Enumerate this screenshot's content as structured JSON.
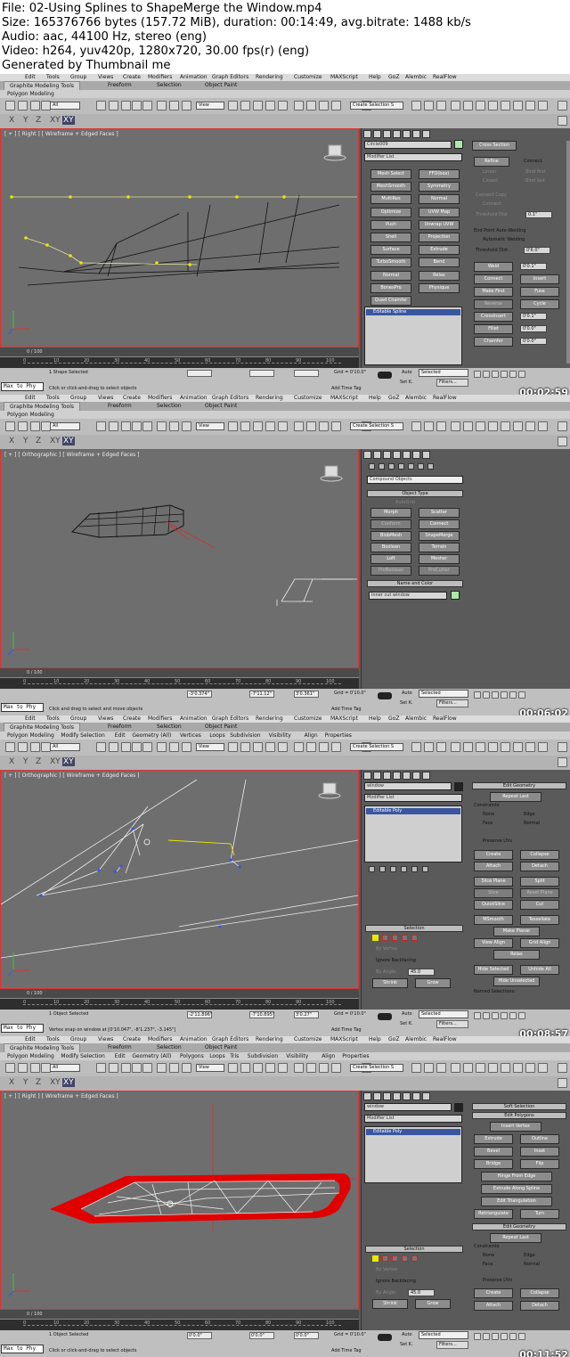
{
  "header": {
    "line1": "File: 02-Using Splines to ShapeMerge the Window.mp4",
    "line2": "Size: 165376766 bytes (157.72 MiB), duration: 00:14:49, avg.bitrate: 1488 kb/s",
    "line3": "Audio: aac, 44100 Hz, stereo (eng)",
    "line4": "Video: h264, yuv420p, 1280x720, 30.00 fps(r) (eng)",
    "line5": "Generated by Thumbnail me"
  },
  "menu": [
    "Edit",
    "Tools",
    "Group",
    "Views",
    "Create",
    "Modifiers",
    "Animation",
    "Graph Editors",
    "Rendering",
    "Customize",
    "MAXScript",
    "Help",
    "GoZ",
    "Alembic",
    "RealFlow"
  ],
  "ribbon_tabs": [
    "Graphite Modeling Tools",
    "Freeform",
    "Selection",
    "Object Paint"
  ],
  "ribbon_sub_default": [
    "Polygon Modeling"
  ],
  "ribbon_sub_f3": [
    "Polygon Modeling",
    "Modify Selection",
    "Edit",
    "Geometry (All)",
    "Vertices",
    "Loops",
    "Subdivision",
    "Visibility",
    "Align",
    "Properties"
  ],
  "ribbon_sub_f4": [
    "Polygon Modeling",
    "Modify Selection",
    "Edit",
    "Geometry (All)",
    "Polygons",
    "Loops",
    "Tris",
    "Subdivision",
    "Visibility",
    "Align",
    "Properties"
  ],
  "toolbar": {
    "filter": "All",
    "view": "View",
    "named_sel": "Create Selection S",
    "axis": [
      "X",
      "Y",
      "Z",
      "XY",
      "XY"
    ]
  },
  "common": {
    "timeline": "0 / 100",
    "max_to": "Max to Phy",
    "add_time_tag": "Add Time Tag",
    "auto": "Auto",
    "setk": "Set K.",
    "selected": "Selected",
    "filters": "Filters...",
    "modifier_list": "Modifier List",
    "ticks": [
      "0",
      "10",
      "20",
      "30",
      "40",
      "50",
      "60",
      "70",
      "80",
      "90",
      "100"
    ]
  },
  "frames": [
    {
      "viewport": "[ + ] [ Right ] [ Wireframe + Edged Faces ]",
      "status1": "1 Shape Selected",
      "status2": "Click or click-and-drag to select objects",
      "grid": "Grid = 0'10.0\"",
      "coords": [
        "",
        "",
        ""
      ],
      "timestamp": "00:02:59",
      "object_name": "Circle009",
      "modifier_buttons": [
        [
          "Mesh Select",
          "FFD(box)"
        ],
        [
          "MeshSmooth",
          "Symmetry"
        ],
        [
          "MultiRes",
          "Normal"
        ],
        [
          "Optimize",
          "UVW Map"
        ],
        [
          "Push",
          "Unwrap UVW"
        ],
        [
          "Shell",
          "Projection"
        ],
        [
          "Surface",
          "Extrude"
        ],
        [
          "TurboSmooth",
          "Bend"
        ],
        [
          "Normal",
          "Relax"
        ],
        [
          "BonesPro",
          "Physique"
        ],
        [
          "Quad Chamfer",
          ""
        ]
      ],
      "stack_item": "Editable Spline",
      "right": {
        "cross_section": "Cross Section",
        "refine": "Refine",
        "connect_chk": "Connect",
        "linear": "Linear",
        "bind_first": "Bind first",
        "closed": "Closed",
        "bind_last": "Bind last",
        "connect_copy": "Connect Copy",
        "connect2": "Connect",
        "threshold": "Threshold Dist",
        "threshold_val": "0.1\"",
        "end_weld": "End Point Auto-Welding",
        "auto_weld": "Automatic Welding",
        "threshold2": "Threshold Dist.",
        "threshold2_val": "0'6.0\"",
        "weld": "Weld",
        "weld_val": "0'0.1\"",
        "connect_btn": "Connect",
        "insert": "Insert",
        "make_first": "Make First",
        "fuse": "Fuse",
        "reverse": "Reverse",
        "cycle": "Cycle",
        "crossinsert": "CrossInsert",
        "crossinsert_val": "0'0.1\"",
        "fillet": "Fillet",
        "fillet_val": "0'0.0\"",
        "chamfer": "Chamfer",
        "chamfer_val": "0'0.0\""
      }
    },
    {
      "viewport": "[ + ] [ Orthographic ] [ Wireframe + Edged Faces ]",
      "status1": "",
      "status2": "Click and drag to select and move objects",
      "grid": "Grid = 0'10.0\"",
      "coords": [
        "-3'0.374\"",
        "-7'11.12\"",
        "3'0.361\""
      ],
      "timestamp": "00:06:02",
      "dropdown": "Compound Objects",
      "object_type": "Object Type",
      "autogrid": "AutoGrid",
      "buttons": [
        [
          "Morph",
          "Scatter"
        ],
        [
          "Conform",
          "Connect"
        ],
        [
          "BlobMesh",
          "ShapeMerge"
        ],
        [
          "Boolean",
          "Terrain"
        ],
        [
          "Loft",
          "Mesher"
        ],
        [
          "ProBoolean",
          "ProCutter"
        ]
      ],
      "name_color": "Name and Color",
      "name": "inner cut window"
    },
    {
      "viewport": "[ + ] [ Orthographic ] [ Wireframe + Edged Faces ]",
      "status1": "1 Object Selected",
      "status2": "Vertex snap on window at [0'10.047\", -8'1.237\", -3.145\"]",
      "grid": "Grid = 0'10.0\"",
      "coords": [
        "-2'11.896\"",
        "-7'10.895\"",
        "3'0.27\""
      ],
      "timestamp": "00:08:57",
      "object_name": "window",
      "stack_item": "Editable Poly",
      "selection": "Selection",
      "by_vertex": "By Vertex",
      "ignore_backfacing": "Ignore Backfacing",
      "by_angle": "By Angle:",
      "by_angle_val": "45.0",
      "shrink": "Shrink",
      "grow": "Grow",
      "right": {
        "edit_geometry": "Edit Geometry",
        "repeat_last": "Repeat Last",
        "constraints": "Constraints",
        "none": "None",
        "edge": "Edge",
        "face": "Face",
        "normal": "Normal",
        "preserve_uvs": "Preserve UVs",
        "create": "Create",
        "collapse": "Collapse",
        "attach": "Attach",
        "detach": "Detach",
        "slice_plane": "Slice Plane",
        "split": "Split",
        "slice": "Slice",
        "reset_plane": "Reset Plane",
        "quickslice": "QuickSlice",
        "cut": "Cut",
        "msmooth": "MSmooth",
        "tessellate": "Tessellate",
        "make_planar": "Make Planar",
        "view_align": "View Align",
        "grid_align": "Grid Align",
        "relax": "Relax",
        "hide_selected": "Hide Selected",
        "unhide_all": "Unhide All",
        "hide_unselected": "Hide Unselected",
        "named_selections": "Named Selections:"
      }
    },
    {
      "viewport": "[ + ] [ Right ] [ Wireframe + Edged Faces ]",
      "status1": "1 Object Selected",
      "status2": "Click or click-and-drag to select objects",
      "grid": "Grid = 0'10.0\"",
      "coords": [
        "0'0.0\"",
        "0'0.0\"",
        "0'0.0\""
      ],
      "timestamp": "00:11:52",
      "object_name": "window",
      "stack_item": "Editable Poly",
      "selection": "Selection",
      "by_vertex": "By Vertex",
      "ignore_backfacing": "Ignore Backfacing",
      "by_angle": "By Angle:",
      "by_angle_val": "45.0",
      "shrink": "Shrink",
      "grow": "Grow",
      "right": {
        "soft_selection": "Soft Selection",
        "edit_polygons": "Edit Polygons",
        "insert_vertex": "Insert Vertex",
        "extrude": "Extrude",
        "outline": "Outline",
        "bevel": "Bevel",
        "inset": "Inset",
        "bridge": "Bridge",
        "flip": "Flip",
        "hinge": "Hinge From Edge",
        "extrude_spline": "Extrude Along Spline",
        "edit_triangulation": "Edit Triangulation",
        "retriangulate": "Retriangulate",
        "turn": "Turn",
        "edit_geometry": "Edit Geometry",
        "repeat_last": "Repeat Last",
        "constraints": "Constraints",
        "none": "None",
        "edge": "Edge",
        "face": "Face",
        "normal": "Normal",
        "preserve_uvs": "Preserve UVs",
        "create": "Create",
        "collapse": "Collapse",
        "attach": "Attach",
        "detach": "Detach"
      }
    }
  ],
  "colors": {
    "viewport_border": "#dd3333",
    "red_frame": "#e00000",
    "accent_yellow": "#e8e800"
  }
}
